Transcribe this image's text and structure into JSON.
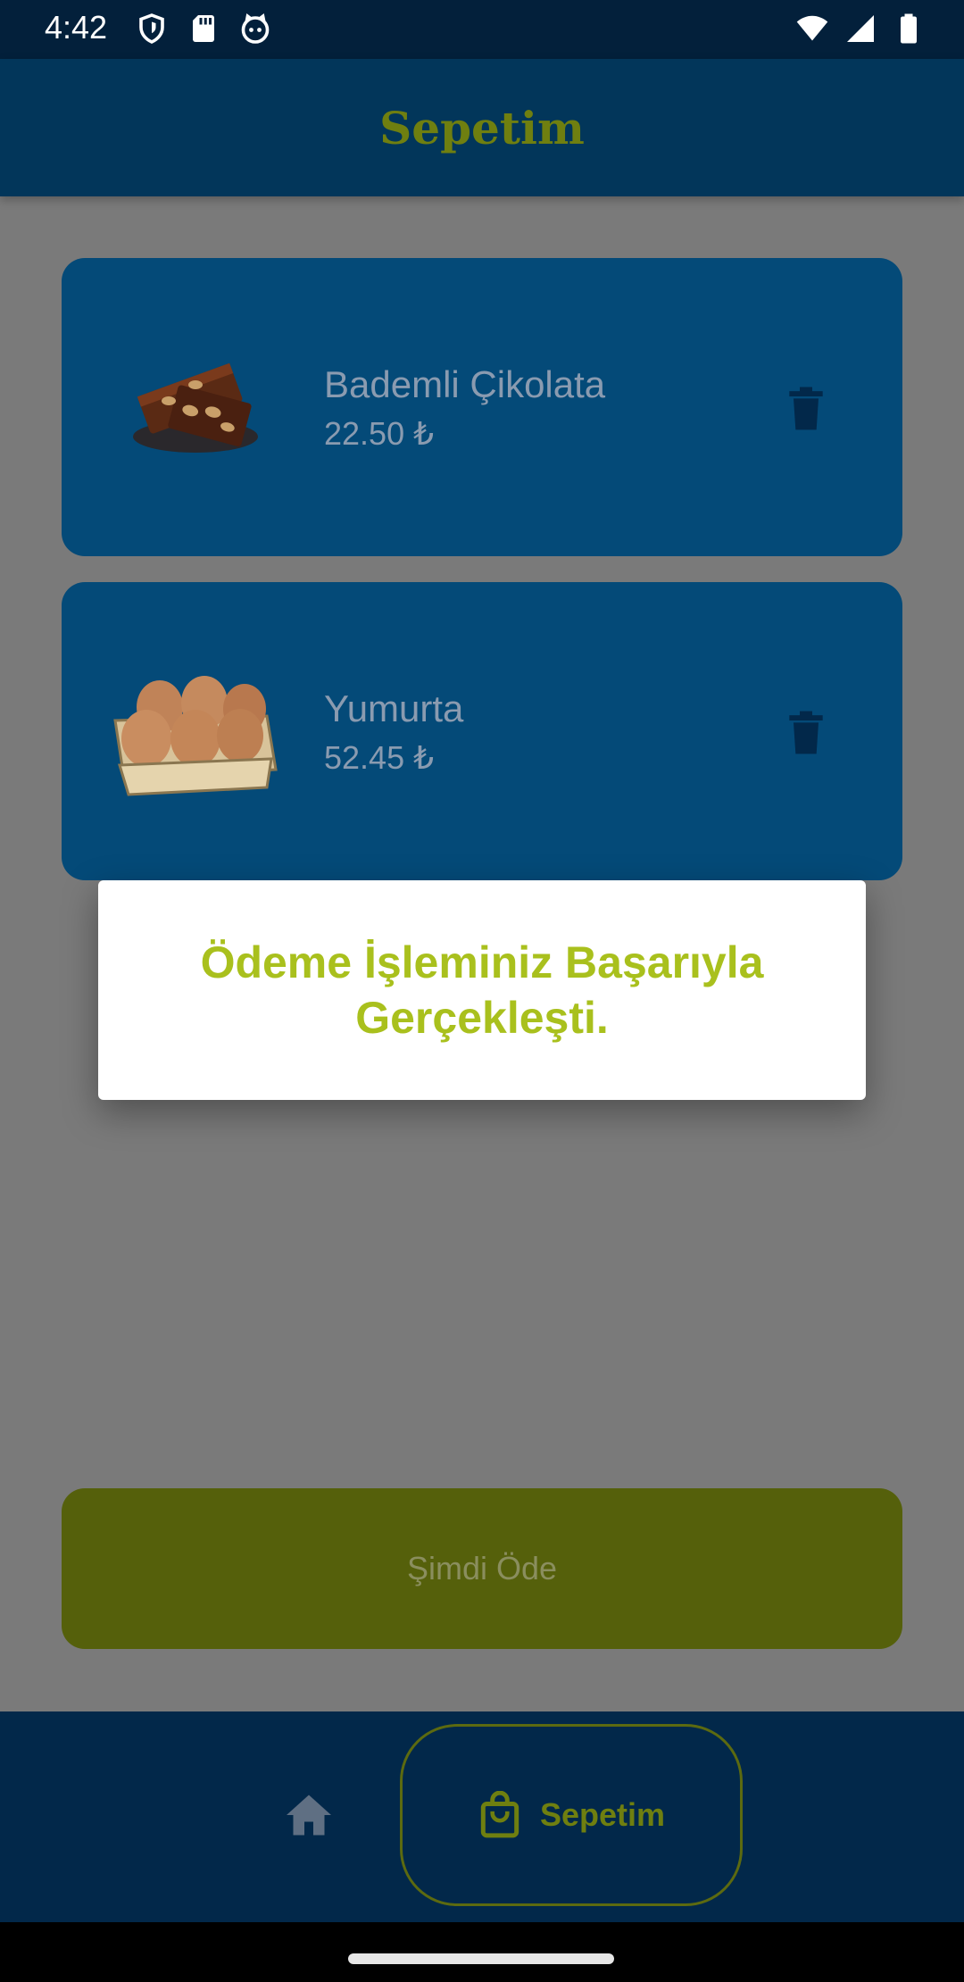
{
  "status_bar": {
    "time": "4:42",
    "left_icons": [
      "shield-icon",
      "sd-card-icon",
      "cat-face-icon"
    ],
    "right_icons": [
      "wifi-icon",
      "signal-icon",
      "battery-icon"
    ]
  },
  "app_bar": {
    "title": "Sepetim",
    "title_color": "#6f7f10",
    "background": "#02365a"
  },
  "cart": {
    "items": [
      {
        "name": "Bademli Çikolata",
        "price": "22.50 ₺",
        "image": "chocolate-image",
        "delete_icon": "trash-icon"
      },
      {
        "name": "Yumurta",
        "price": "52.45 ₺",
        "image": "eggs-image",
        "delete_icon": "trash-icon"
      }
    ]
  },
  "dialog": {
    "message": "Ödeme İşleminiz Başarıyla Gerçekleşti.",
    "text_color": "#a9c01d"
  },
  "pay_button": {
    "label": "Şimdi Öde"
  },
  "bottom_nav": {
    "items": [
      {
        "icon": "home-icon",
        "label": ""
      },
      {
        "icon": "shopping-bag-icon",
        "label": "Sepetim",
        "selected": true
      }
    ]
  }
}
